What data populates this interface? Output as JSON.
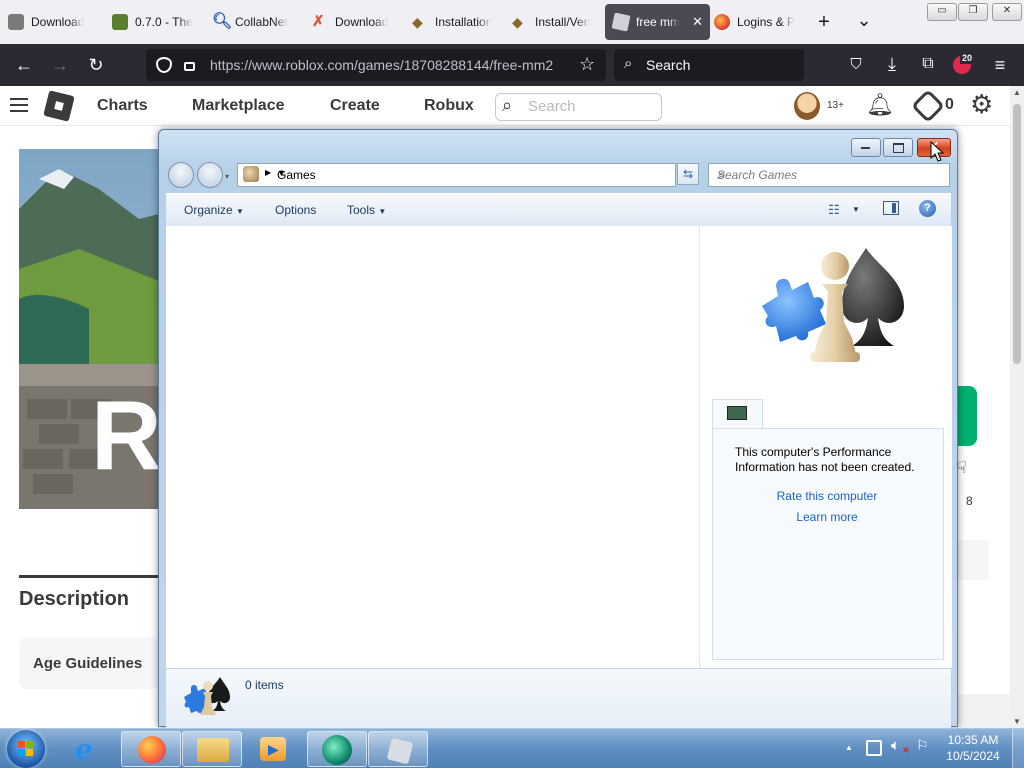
{
  "browser": {
    "tabs": [
      {
        "label": "Download",
        "fav": "#7a7a7a"
      },
      {
        "label": "0.7.0 - The",
        "fav": "#5a7f2e"
      },
      {
        "label": "CollabNet",
        "fav": "#2b5db8"
      },
      {
        "label": "Download",
        "fav": "#e0543a"
      },
      {
        "label": "Installation",
        "fav": "#b88a3a"
      },
      {
        "label": "Install/Veri",
        "fav": "#b88a3a"
      },
      {
        "label": "free mm",
        "fav": "#d0d0d8"
      },
      {
        "label": "Logins & P",
        "fav": "#e04a2c"
      }
    ],
    "active_tab_close": "✕",
    "new_tab": "+",
    "tab_list": "⌄",
    "url_host": "https://www.roblox.com",
    "url_path": "/games/18708288144/free-mm2",
    "search_placeholder": "Search",
    "badge_count": "20"
  },
  "roblox": {
    "nav": {
      "charts": "Charts",
      "marketplace": "Marketplace",
      "create": "Create",
      "robux": "Robux"
    },
    "search_placeholder": "Search",
    "age_badge": "13+",
    "robux_count": "0",
    "hero_letter": "R",
    "description_heading": "Description",
    "age_guidelines": "Age Guidelines",
    "side_count": "8"
  },
  "games_window": {
    "breadcrumb": "Games",
    "search_placeholder": "Search Games",
    "commands": {
      "organize": "Organize",
      "options": "Options",
      "tools": "Tools"
    },
    "perf_message": "This computer's Performance Information has not been created.",
    "rate_link": "Rate this computer",
    "learn_link": "Learn more",
    "status_items": "0 items"
  },
  "taskbar": {
    "time": "10:35 AM",
    "date": "10/5/2024"
  },
  "colors": {
    "roblox_green": "#00b06f",
    "link_blue": "#1b63c6"
  }
}
